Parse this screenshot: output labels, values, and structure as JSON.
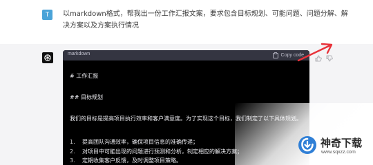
{
  "user": {
    "avatar_letter": "T",
    "message": "以markdown格式，帮我出一份工作汇报文案，要求包含目标规划、可能问题、问题分解、解决方案以及方案执行情况"
  },
  "assistant": {
    "code_block": {
      "language": "markdown",
      "copy_label": "Copy code",
      "lines": [
        "# 工作汇报",
        "## 目标规划",
        "我们的目标是提高项目执行效率和客户满意度。为了实现这个目标，我们制定了以下具体规划。",
        "提高团队沟通效率，确保项目信息的准确传递；",
        "对项目中可能出现的问题进行预测和分析，制定相应的解决方案；",
        "定期收集客户反馈，及时调整项目策略。"
      ],
      "line_numbers": [
        "1.",
        "2.",
        "3."
      ]
    }
  },
  "watermark": {
    "title": "神奇下载",
    "url": "www.sqxzz.com"
  },
  "colors": {
    "annotation_arrow": "#e8323a",
    "watermark_blue": "#2f7fd6"
  }
}
